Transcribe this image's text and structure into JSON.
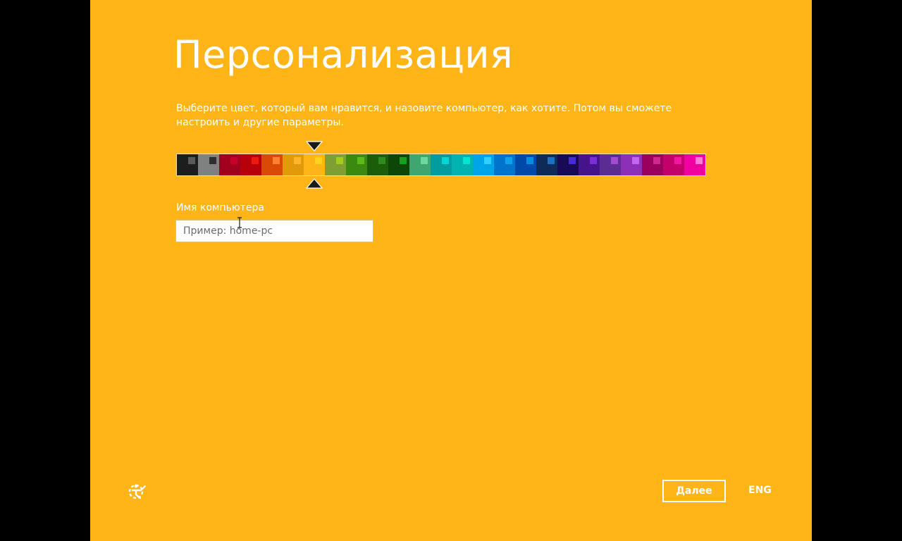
{
  "page": {
    "title": "Персонализация",
    "description": "Выберите цвет, который вам нравится, и назовите компьютер, как хотите. Потом вы сможете настроить и другие параметры."
  },
  "palette": {
    "selected_index": 6,
    "swatches": [
      {
        "bg": "#1D1D1D",
        "accent": "#5A5A5A"
      },
      {
        "bg": "#7F8180",
        "accent": "#2E2E2E"
      },
      {
        "bg": "#A0001D",
        "accent": "#C8002A"
      },
      {
        "bg": "#B8000C",
        "accent": "#F01910"
      },
      {
        "bg": "#D84A05",
        "accent": "#FF8030"
      },
      {
        "bg": "#E39A0A",
        "accent": "#FFB62A"
      },
      {
        "bg": "#FFB518",
        "accent": "#FFD21E"
      },
      {
        "bg": "#7F9F33",
        "accent": "#A5CC1A"
      },
      {
        "bg": "#3B8A0F",
        "accent": "#5CBB1A"
      },
      {
        "bg": "#1B5D0A",
        "accent": "#2F8C1E"
      },
      {
        "bg": "#0C4707",
        "accent": "#17A01D"
      },
      {
        "bg": "#3FA672",
        "accent": "#6DDA9D"
      },
      {
        "bg": "#009C9E",
        "accent": "#00D6D3"
      },
      {
        "bg": "#00B3B0",
        "accent": "#00E5D2"
      },
      {
        "bg": "#00A4E8",
        "accent": "#2FD0FF"
      },
      {
        "bg": "#0074CC",
        "accent": "#0CA2E8"
      },
      {
        "bg": "#0049A8",
        "accent": "#008FE0"
      },
      {
        "bg": "#0E2A57",
        "accent": "#1E70C2"
      },
      {
        "bg": "#190A56",
        "accent": "#4A2BD3"
      },
      {
        "bg": "#45138A",
        "accent": "#7A2DD8"
      },
      {
        "bg": "#5B2D92",
        "accent": "#A54ACF"
      },
      {
        "bg": "#8E2FB8",
        "accent": "#C665F0"
      },
      {
        "bg": "#9A005E",
        "accent": "#CF288E"
      },
      {
        "bg": "#C4006B",
        "accent": "#F515A3"
      },
      {
        "bg": "#F000A0",
        "accent": "#FF7BD8"
      }
    ]
  },
  "computer_name": {
    "label": "Имя компьютера",
    "placeholder": "Пример: home-pc"
  },
  "footer": {
    "next_label": "Далее",
    "language": "ENG"
  },
  "colors": {
    "background": "#FFB518",
    "text": "#FFFFFF",
    "frame": "#000000"
  },
  "icons": {
    "ease_of_access": "ease-of-access-icon",
    "selector_top": "triangle-down-icon",
    "selector_bottom": "triangle-up-icon"
  }
}
